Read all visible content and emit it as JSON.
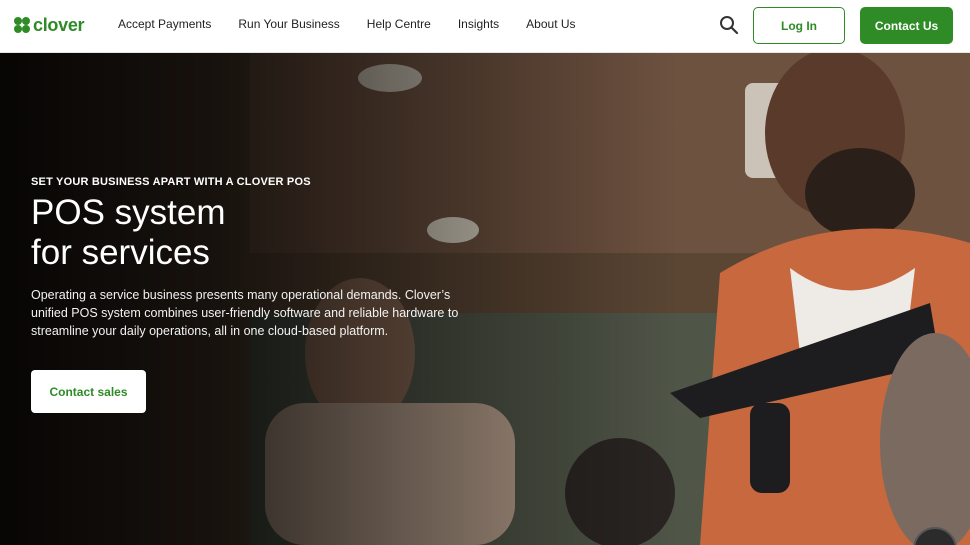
{
  "header": {
    "logo_text": "clover",
    "nav": [
      "Accept Payments",
      "Run Your Business",
      "Help Centre",
      "Insights",
      "About Us"
    ],
    "login_label": "Log In",
    "contact_label": "Contact Us"
  },
  "hero": {
    "eyebrow": "SET YOUR BUSINESS APART WITH A CLOVER POS",
    "headline_line1": "POS system",
    "headline_line2": "for services",
    "description": "Operating a service business presents many operational demands. Clover’s unified POS system combines user-friendly software and reliable hardware to streamline your daily operations, all in one cloud-based platform.",
    "cta_label": "Contact sales"
  },
  "colors": {
    "brand_green": "#2e8b26",
    "white": "#ffffff"
  },
  "icons": {
    "logo": "clover-leaf-icon",
    "search": "search-icon",
    "chat": "chat-icon"
  }
}
